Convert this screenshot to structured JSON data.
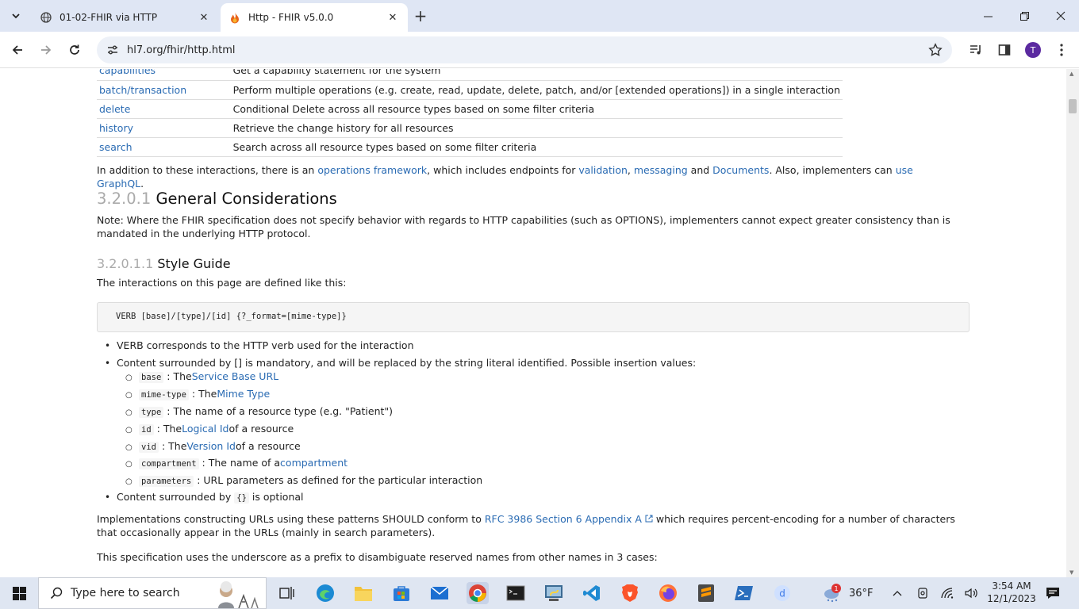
{
  "browser": {
    "tabs": [
      {
        "title": "01-02-FHIR via HTTP"
      },
      {
        "title": "Http - FHIR v5.0.0"
      }
    ],
    "url": "hl7.org/fhir/http.html",
    "profile_initial": "T"
  },
  "page": {
    "interactions": [
      {
        "name": "capabilities",
        "desc": "Get a capability statement for the system"
      },
      {
        "name": "batch/transaction",
        "desc": "Perform multiple operations (e.g. create, read, update, delete, patch, and/or [extended operations]) in a single interaction"
      },
      {
        "name": "delete",
        "desc": "Conditional Delete across all resource types based on some filter criteria"
      },
      {
        "name": "history",
        "desc": "Retrieve the change history for all resources"
      },
      {
        "name": "search",
        "desc": "Search across all resource types based on some filter criteria"
      }
    ],
    "intro": {
      "t1": "In addition to these interactions, there is an ",
      "l1": "operations framework",
      "t2": ", which includes endpoints for ",
      "l2": "validation",
      "t3": ", ",
      "l3": "messaging",
      "t4": " and ",
      "l4": "Documents",
      "t5": ". Also, implementers can ",
      "l5": "use GraphQL",
      "t6": "."
    },
    "h_general": {
      "num": "3.2.0.1",
      "title": "General Considerations"
    },
    "note": "Note: Where the FHIR specification does not specify behavior with regards to HTTP capabilities (such as OPTIONS), implementers cannot expect greater consistency than is mandated in the underlying HTTP protocol.",
    "h_style": {
      "num": "3.2.0.1.1",
      "title": "Style Guide"
    },
    "style_intro": "The interactions on this page are defined like this:",
    "code": "VERB [base]/[type]/[id] {?_format=[mime-type]}",
    "bullet1": "VERB corresponds to the HTTP verb used for the interaction",
    "bullet2": "Content surrounded by [] is mandatory, and will be replaced by the string literal identified. Possible insertion values:",
    "subs": [
      {
        "code": "base",
        "pre": ": The ",
        "link": "Service Base URL",
        "post": ""
      },
      {
        "code": "mime-type",
        "pre": ": The ",
        "link": "Mime Type",
        "post": ""
      },
      {
        "code": "type",
        "pre": ": The name of a resource type (e.g. \"Patient\")",
        "link": "",
        "post": ""
      },
      {
        "code": "id",
        "pre": ": The ",
        "link": "Logical Id",
        "post": " of a resource"
      },
      {
        "code": "vid",
        "pre": ": The ",
        "link": "Version Id",
        "post": " of a resource"
      },
      {
        "code": "compartment",
        "pre": ": The name of a ",
        "link": "compartment",
        "post": ""
      },
      {
        "code": "parameters",
        "pre": ": URL parameters as defined for the particular interaction",
        "link": "",
        "post": ""
      }
    ],
    "bullet3_pre": "Content surrounded by ",
    "bullet3_code": "{}",
    "bullet3_post": " is optional",
    "impl": {
      "t1": "Implementations constructing URLs using these patterns SHOULD conform to ",
      "link": "RFC 3986 Section 6 Appendix A",
      "t2": " which requires percent-encoding for a number of characters that occasionally appear in the URLs (mainly in search parameters)."
    },
    "underscore": "This specification uses the underscore as a prefix to disambiguate reserved names from other names in 3 cases:"
  },
  "taskbar": {
    "search_placeholder": "Type here to search",
    "weather": "36°F",
    "weather_badge": "1",
    "time": "3:54 AM",
    "date": "12/1/2023"
  }
}
